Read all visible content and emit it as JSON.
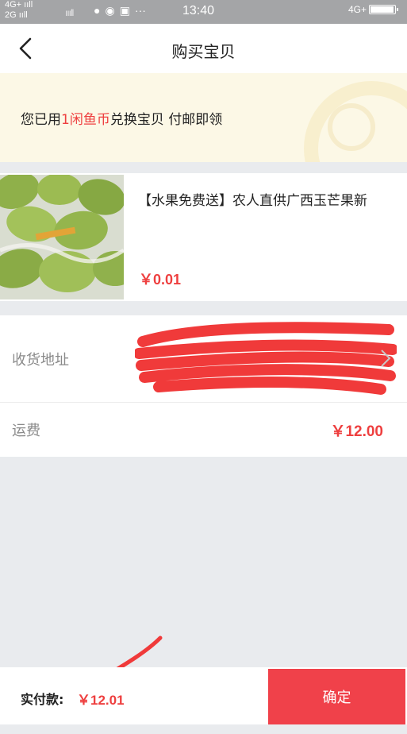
{
  "status_bar": {
    "network_1": "4G+",
    "network_2": "2G",
    "time": "13:40",
    "right_network": "4G+"
  },
  "nav": {
    "title": "购买宝贝",
    "back_icon": "chevron-left-icon"
  },
  "banner": {
    "text_before": "您已用",
    "highlight": "1闲鱼币",
    "text_after": "兑换宝贝 付邮即领"
  },
  "product": {
    "title": "【水果免费送】农人直供广西玉芒果新",
    "price": "￥0.01"
  },
  "address": {
    "label": "收货地址"
  },
  "freight": {
    "label": "运费",
    "value": "￥12.00"
  },
  "bottom": {
    "pay_label": "实付款:",
    "pay_amount": "￥12.01",
    "confirm_label": "确定"
  },
  "colors": {
    "accent": "#ee3f3f",
    "button": "#f0414a",
    "banner_bg": "#fcf8e6",
    "page_bg": "#e9ebee"
  }
}
